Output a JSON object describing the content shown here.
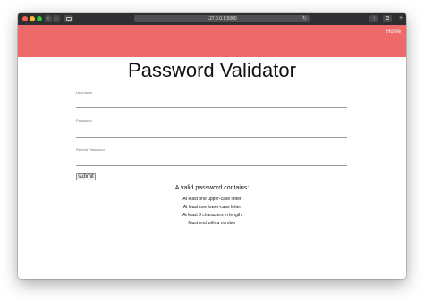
{
  "browser": {
    "address": "127.0.0.1:5000"
  },
  "app": {
    "header_color": "#ee6a6a",
    "nav": {
      "home_label": "Home"
    },
    "title": "Password Validator"
  },
  "form": {
    "username": {
      "label": "Username",
      "value": ""
    },
    "password": {
      "label": "Password",
      "value": ""
    },
    "repeat_password": {
      "label": "Repeat Password",
      "value": ""
    },
    "submit_label": "submit"
  },
  "rules": {
    "heading": "A valid password contains:",
    "items": [
      "At least one upper-case letter",
      "At least one lower-case letter",
      "At least 8 characters in length",
      "Must end with a number"
    ]
  }
}
